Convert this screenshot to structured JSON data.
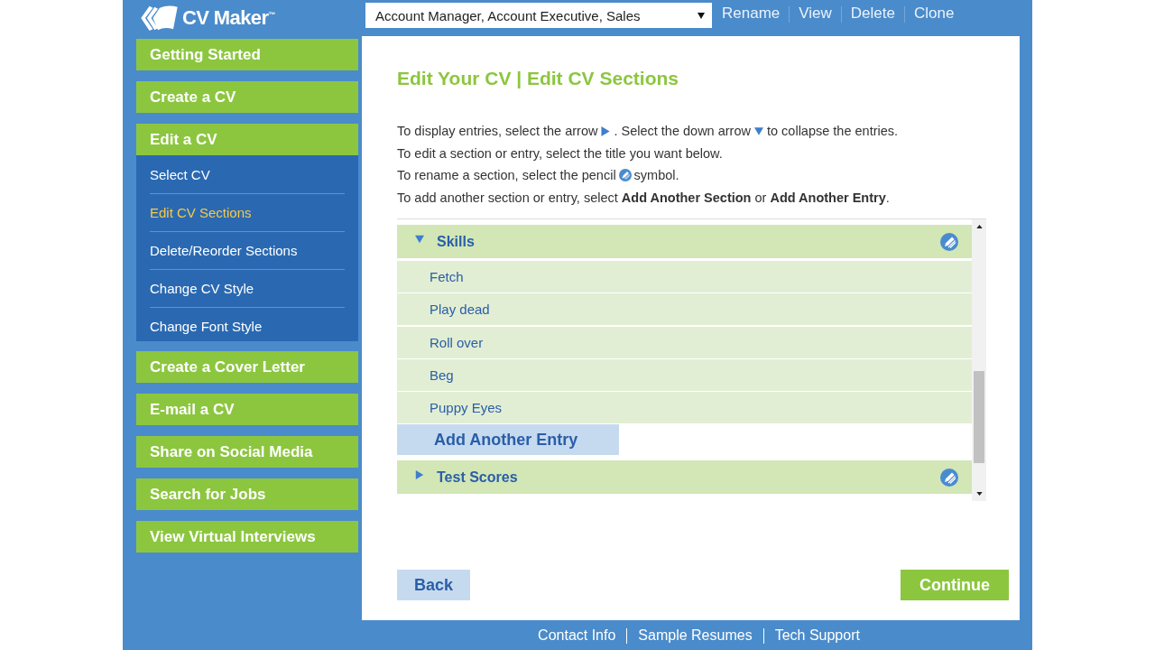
{
  "header": {
    "logo": "CV Maker$^{™}$",
    "cv_select": {
      "value": "Account Manager, Account Executive, Sales"
    },
    "actions": [
      "Rename",
      "View",
      "Delete",
      "Clone"
    ]
  },
  "sidebar": {
    "items": [
      {
        "label": "Getting Started",
        "expanded": false
      },
      {
        "label": "Create a CV",
        "expanded": false
      },
      {
        "label": "Edit a CV",
        "expanded": true,
        "children": [
          {
            "label": "Select CV",
            "selected": false
          },
          {
            "label": "Edit CV Sections",
            "selected": true
          },
          {
            "label": "Delete/Reorder Sections",
            "selected": false
          },
          {
            "label": "Change CV Style",
            "selected": false
          },
          {
            "label": "Change Font Style",
            "selected": false
          }
        ]
      },
      {
        "label": "Create a Cover Letter",
        "expanded": false
      },
      {
        "label": "E-mail a CV",
        "expanded": false
      },
      {
        "label": "Share on Social Media",
        "expanded": false
      },
      {
        "label": "Search for Jobs",
        "expanded": false
      },
      {
        "label": "View Virtual Interviews",
        "expanded": false
      }
    ]
  },
  "main": {
    "title": "Edit Your CV | Edit CV Sections",
    "instructions": [
      {
        "parts": [
          {
            "kind": "text",
            "text": "To display entries, select the arrow"
          },
          {
            "kind": "expand_arrow"
          },
          {
            "kind": "text",
            "text": ". Select the down arrow"
          },
          {
            "kind": "collapse_arrow"
          },
          {
            "kind": "text",
            "text": "to collapse the entries."
          }
        ]
      },
      {
        "parts": [
          {
            "kind": "text",
            "text": "To edit a section or entry, select the title you want below."
          }
        ]
      },
      {
        "parts": [
          {
            "kind": "text",
            "text": "To rename a section, select the pencil"
          },
          {
            "kind": "pencil"
          },
          {
            "kind": "text",
            "text": "symbol."
          }
        ]
      },
      {
        "parts": [
          {
            "kind": "text",
            "text": "To add another section or entry, select **Add Another Section** or **Add Another Entry**."
          }
        ]
      }
    ],
    "sections": [
      {
        "title": "Skills",
        "expanded": true,
        "entries": [
          "Fetch",
          "Play dead",
          "Roll over",
          "Beg",
          "Puppy Eyes"
        ],
        "add_entry": "Add Another Entry"
      },
      {
        "title": "Test Scores",
        "expanded": false
      }
    ],
    "buttons": [
      {
        "label": "Back",
        "kind": "secondary"
      },
      {
        "label": "Continue",
        "kind": "primary"
      }
    ]
  },
  "footer": {
    "links": [
      "Contact Info",
      "Sample Resumes",
      "Tech Support"
    ]
  }
}
